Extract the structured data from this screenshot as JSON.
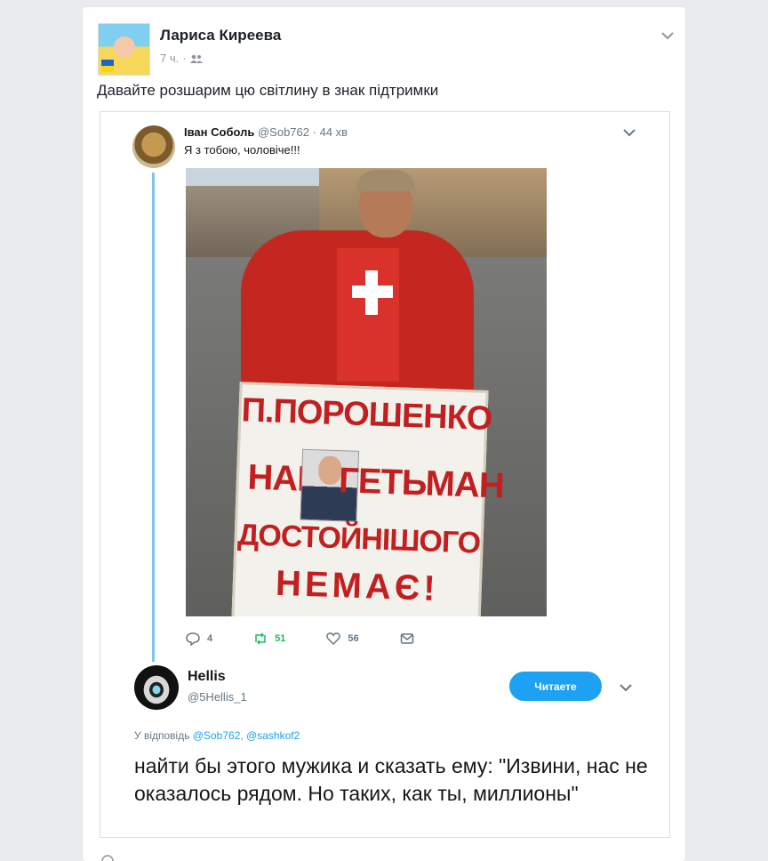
{
  "post": {
    "author": "Лариса Киреева",
    "time": "7 ч.",
    "separator": "·",
    "privacy_icon": "friends-icon",
    "text": "Давайте розшарим цю світлину в знак підтримки"
  },
  "tweet": {
    "author": "Іван Соболь",
    "handle": "@Sob762",
    "time": "· 44 хв",
    "text": "Я з тобою, чоловіче!!!",
    "photo": {
      "sign_lines": [
        "П.ПОРОШЕНКО",
        "НАШ",
        "ГЕТЬМАН",
        "ДОСТОЙНІШОГО",
        "НЕМАЄ!"
      ]
    },
    "actions": {
      "replies": "4",
      "retweets": "51",
      "likes": "56"
    }
  },
  "reply": {
    "author": "Hellis",
    "handle": "@5Hellis_1",
    "follow_label": "Читаете",
    "reply_prefix": "У відповідь",
    "mention1": "@Sob762,",
    "mention2": "@sashkof2",
    "text": "найти бы этого мужика и сказать ему: \"Извини, нас не оказалось рядом. Но таких, как ты, миллионы\""
  },
  "colors": {
    "accent": "#1da1f2",
    "retweet": "#17bf63",
    "thread": "#80c7e6",
    "sign_text": "#c21f20"
  }
}
